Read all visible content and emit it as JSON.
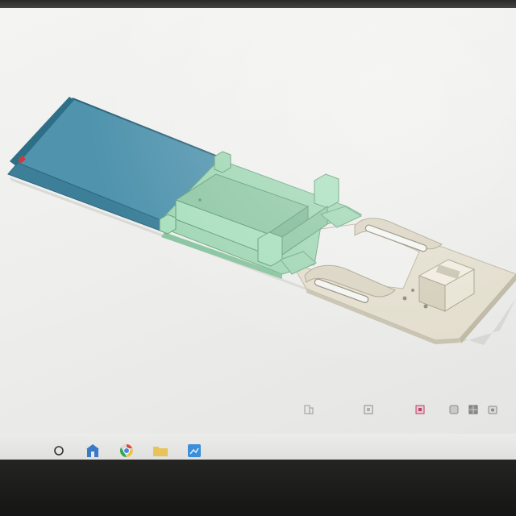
{
  "app": {
    "name": "3D model viewer"
  },
  "model": {
    "description": "",
    "parts": [
      {
        "name": "tray-blue",
        "color": "#4f93ad"
      },
      {
        "name": "mount-green",
        "color": "#9fd6b3"
      },
      {
        "name": "base-beige",
        "color": "#e2ddcc"
      }
    ],
    "accent_color": "#d13a3a"
  },
  "toolbar": {
    "buttons": [
      {
        "icon": "zoom-icon"
      },
      {
        "icon": "fit-view-icon"
      },
      {
        "icon": "section-icon",
        "color": "#c04060"
      },
      {
        "icon": "display-mode-icon"
      },
      {
        "icon": "grid-icon"
      },
      {
        "icon": "camera-icon"
      }
    ]
  },
  "taskbar": {
    "items": [
      {
        "icon": "search-icon"
      },
      {
        "icon": "store-icon",
        "color": "#3a78c8"
      },
      {
        "icon": "chrome-icon"
      },
      {
        "icon": "folder-icon",
        "color": "#e7c45a"
      },
      {
        "icon": "app-icon",
        "color": "#3a8fd8"
      }
    ]
  }
}
